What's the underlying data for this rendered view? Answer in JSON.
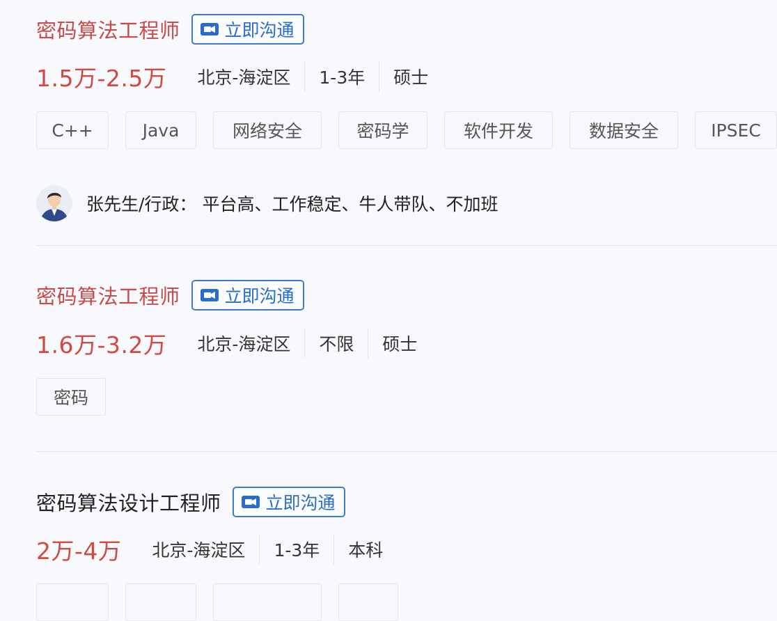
{
  "jobs": [
    {
      "title": "密码算法工程师",
      "chat_label": "立即沟通",
      "salary": "1.5万-2.5万",
      "location": "北京-海淀区",
      "experience": "1-3年",
      "degree": "硕士",
      "tags": [
        "C++",
        "Java",
        "网络安全",
        "密码学",
        "软件开发",
        "数据安全",
        "IPSEC"
      ],
      "recruiter": "张先生/行政：",
      "benefits": "平台高、工作稳定、牛人带队、不加班"
    },
    {
      "title": "密码算法工程师",
      "chat_label": "立即沟通",
      "salary": "1.6万-3.2万",
      "location": "北京-海淀区",
      "experience": "不限",
      "degree": "硕士",
      "tags": [
        "密码"
      ]
    },
    {
      "title": "密码算法设计工程师",
      "chat_label": "立即沟通",
      "salary": "2万-4万",
      "location": "北京-海淀区",
      "experience": "1-3年",
      "degree": "本科"
    }
  ],
  "colors": {
    "title_red": "#c84a4a",
    "salary_red": "#d24a3f",
    "button_blue": "#2a6cc9"
  },
  "icons": {
    "chat": "video-chat-icon",
    "avatar": "avatar"
  }
}
